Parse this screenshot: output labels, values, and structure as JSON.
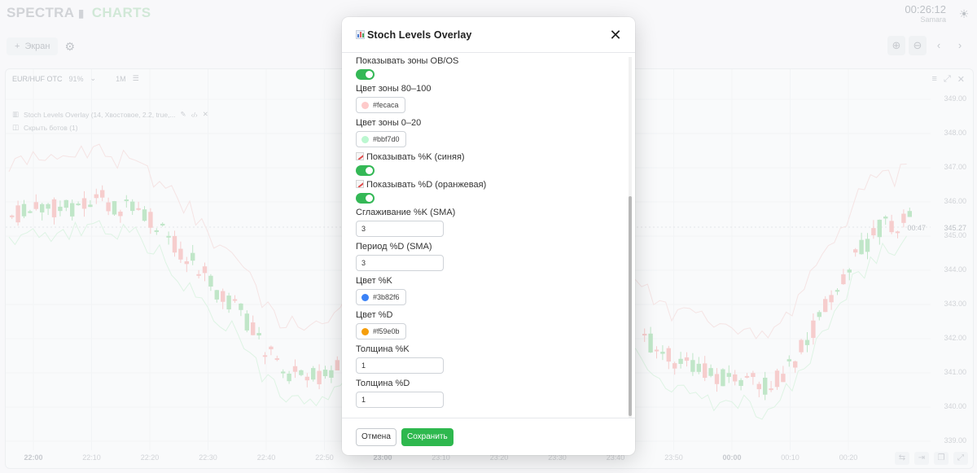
{
  "app": {
    "logo_left": "SPECTRA",
    "logo_right": "CHARTS",
    "time": "00:26:12",
    "timezone": "Samara"
  },
  "toolbar": {
    "screen_label": "Экран"
  },
  "chart_panel": {
    "pair": "EUR/HUF OTC",
    "pair_pct": "91%",
    "timeframe": "1M",
    "indicator_label": "Stoch Levels Overlay (14, Хвостовое, 2.2, true,...",
    "hide_bots_label": "Скрыть ботов (1)",
    "last_price": "345.27",
    "countdown": "00:47",
    "price_ticks": [
      "349.00",
      "348.00",
      "347.00",
      "346.00",
      "345.00",
      "344.00",
      "343.00",
      "342.00",
      "341.00",
      "340.00",
      "339.00"
    ],
    "time_ticks": [
      "22:00",
      "22:10",
      "22:20",
      "22:30",
      "22:40",
      "22:50",
      "23:00",
      "23:10",
      "23:20",
      "23:30",
      "23:40",
      "23:50",
      "00:00",
      "00:10",
      "00:20"
    ]
  },
  "modal": {
    "title": "Stoch Levels Overlay",
    "fields": {
      "show_zones_label": "Показывать зоны OB/OS",
      "zone_80_label": "Цвет зоны 80–100",
      "zone_80_value": "#fecaca",
      "zone_0_label": "Цвет зоны 0–20",
      "zone_0_value": "#bbf7d0",
      "show_k_label": "Показывать %K (синяя)",
      "show_d_label": "Показывать %D (оранжевая)",
      "smooth_k_label": "Сглаживание %K (SMA)",
      "smooth_k_value": "3",
      "period_d_label": "Период %D (SMA)",
      "period_d_value": "3",
      "color_k_label": "Цвет %K",
      "color_k_value": "#3b82f6",
      "color_d_label": "Цвет %D",
      "color_d_value": "#f59e0b",
      "width_k_label": "Толщина %K",
      "width_k_value": "1",
      "width_d_label": "Толщина %D",
      "width_d_value": "1"
    },
    "cancel_label": "Отмена",
    "save_label": "Сохранить"
  },
  "colors": {
    "accent_green": "#2eb84e",
    "bull": "#9fd9ab",
    "bear": "#f2b3b3"
  }
}
